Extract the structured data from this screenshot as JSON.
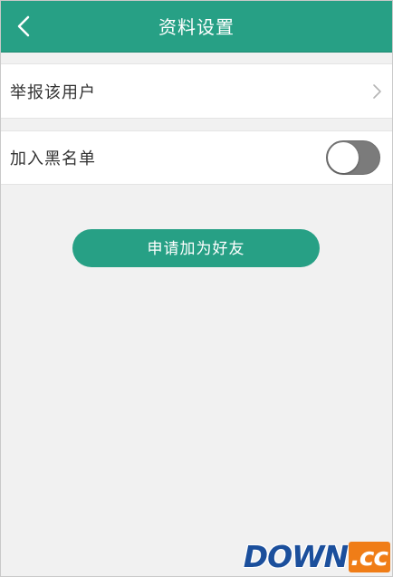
{
  "header": {
    "title": "资料设置",
    "back_icon": "chevron-left-icon",
    "background": "#27a085"
  },
  "settings": {
    "report_label": "举报该用户",
    "report_icon": "chevron-right-icon",
    "blacklist_label": "加入黑名单",
    "blacklist_on": false
  },
  "actions": {
    "add_friend_label": "申请加为好友",
    "accent": "#27a085"
  },
  "watermark": {
    "main": "DOWN",
    "suffix": ".cc"
  }
}
